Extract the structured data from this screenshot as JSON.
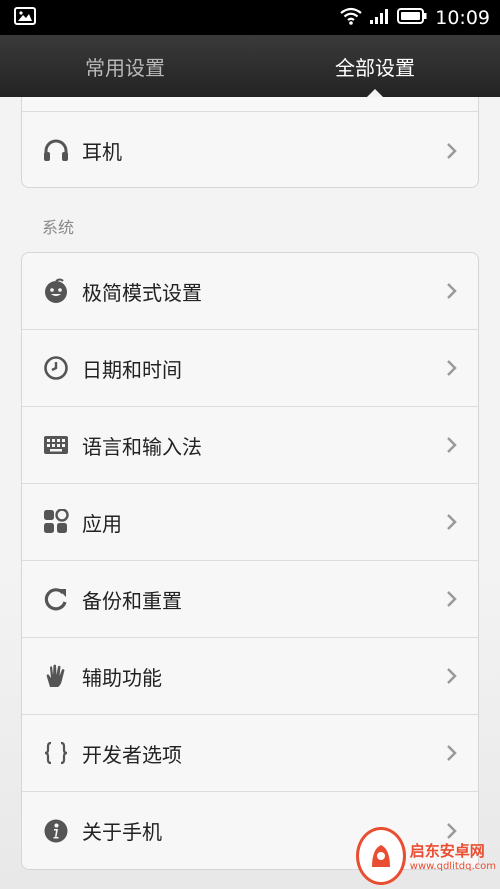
{
  "status_bar": {
    "time": "10:09",
    "icons": [
      "gallery-notification-icon",
      "wifi-icon",
      "signal-icon",
      "battery-icon"
    ]
  },
  "tabs": [
    {
      "label": "常用设置",
      "active": false
    },
    {
      "label": "全部设置",
      "active": true
    }
  ],
  "top_card": {
    "items": [
      {
        "label": "耳机",
        "icon": "headphones-icon"
      }
    ]
  },
  "system_section": {
    "label": "系统",
    "items": [
      {
        "label": "极简模式设置",
        "icon": "simple-mode-face-icon"
      },
      {
        "label": "日期和时间",
        "icon": "clock-icon"
      },
      {
        "label": "语言和输入法",
        "icon": "keyboard-icon"
      },
      {
        "label": "应用",
        "icon": "apps-grid-icon"
      },
      {
        "label": "备份和重置",
        "icon": "backup-refresh-icon"
      },
      {
        "label": "辅助功能",
        "icon": "hand-icon"
      },
      {
        "label": "开发者选项",
        "icon": "braces-icon"
      },
      {
        "label": "关于手机",
        "icon": "info-icon"
      }
    ]
  },
  "watermark": {
    "title": "启东安卓网",
    "url": "www.qdlitdq.com"
  },
  "colors": {
    "status_bar_bg": "#000000",
    "tab_bar_bg": "#2b2b2b",
    "page_bg": "#f3f3f3",
    "icon_gray": "#555555",
    "chevron_gray": "#9a9a9a",
    "watermark_red": "#e94e33"
  }
}
